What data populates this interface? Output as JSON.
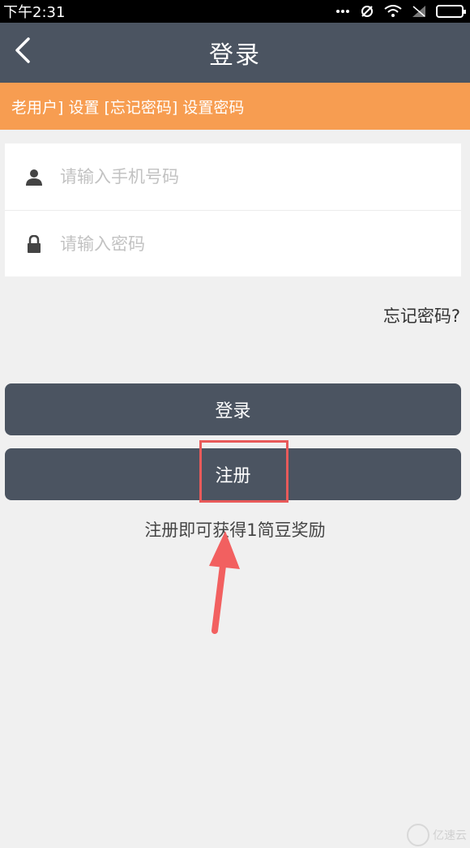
{
  "status_bar": {
    "time": "下午2:31",
    "icons": [
      "signal-dots-icon",
      "sync-icon",
      "wifi-icon",
      "no-sim-icon",
      "battery-icon"
    ]
  },
  "nav": {
    "title": "登录",
    "back_icon": "chevron-left-icon"
  },
  "notice": {
    "text": "老用户] 设置 [忘记密码] 设置密码"
  },
  "form": {
    "phone": {
      "placeholder": "请输入手机号码",
      "icon": "user-icon"
    },
    "password": {
      "placeholder": "请输入密码",
      "icon": "lock-icon"
    }
  },
  "forgot_password": "忘记密码?",
  "buttons": {
    "login": "登录",
    "register": "注册"
  },
  "hint": "注册即可获得1简豆奖励",
  "watermark": "亿速云",
  "colors": {
    "nav_bg": "#4b5461",
    "notice_bg": "#f79d51",
    "page_bg": "#f0f0f0",
    "annotation": "#e85a5a"
  }
}
